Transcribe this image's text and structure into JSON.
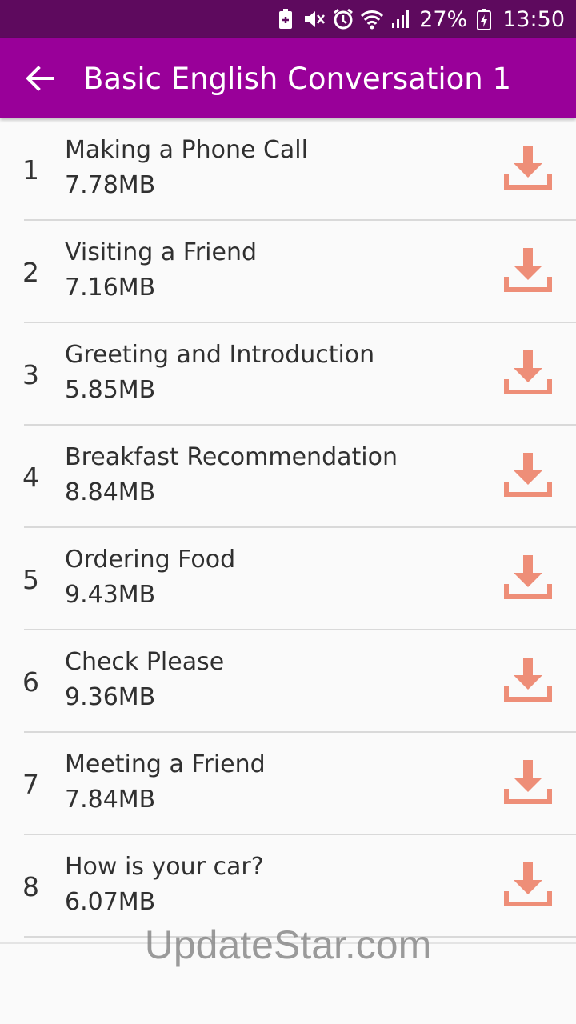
{
  "status_bar": {
    "battery_percent": "27%",
    "time": "13:50",
    "icons": [
      "battery-saver-icon",
      "mute-icon",
      "alarm-icon",
      "wifi-icon",
      "signal-icon",
      "battery-charging-icon"
    ]
  },
  "app_bar": {
    "title": "Basic English Conversation 1",
    "back_icon": "arrow-left-icon"
  },
  "lessons": [
    {
      "number": "1",
      "title": "Making a Phone Call",
      "size": "7.78MB"
    },
    {
      "number": "2",
      "title": "Visiting a Friend",
      "size": "7.16MB"
    },
    {
      "number": "3",
      "title": "Greeting and Introduction",
      "size": "5.85MB"
    },
    {
      "number": "4",
      "title": "Breakfast Recommendation",
      "size": "8.84MB"
    },
    {
      "number": "5",
      "title": "Ordering Food",
      "size": "9.43MB"
    },
    {
      "number": "6",
      "title": "Check Please",
      "size": "9.36MB"
    },
    {
      "number": "7",
      "title": "Meeting a Friend",
      "size": "7.84MB"
    },
    {
      "number": "8",
      "title": "How is your car?",
      "size": "6.07MB"
    }
  ],
  "watermark": "UpdateStar.com",
  "colors": {
    "status_bar": "#5e0a5e",
    "app_bar": "#990099",
    "download_icon": "#ee8e78"
  }
}
